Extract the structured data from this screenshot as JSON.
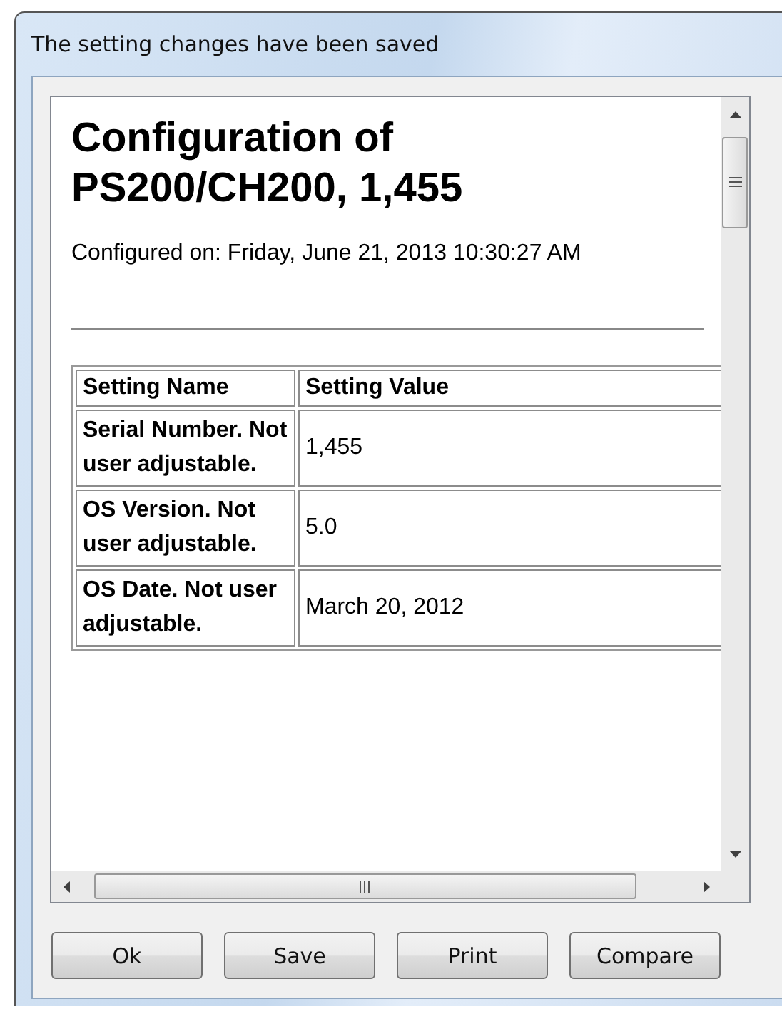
{
  "window": {
    "title": "The setting changes have been saved"
  },
  "document": {
    "heading": "Configuration of PS200/CH200, 1,455",
    "configured_on": "Configured on: Friday, June 21, 2013 10:30:27 AM",
    "table": {
      "columns": [
        "Setting Name",
        "Setting Value"
      ],
      "rows": [
        {
          "name": "Serial Number. Not user adjustable.",
          "value": "1,455"
        },
        {
          "name": "OS Version. Not user adjustable.",
          "value": "5.0"
        },
        {
          "name": "OS Date. Not user adjustable.",
          "value": "March 20, 2012"
        }
      ]
    }
  },
  "buttons": [
    "Ok",
    "Save",
    "Print",
    "Compare"
  ]
}
